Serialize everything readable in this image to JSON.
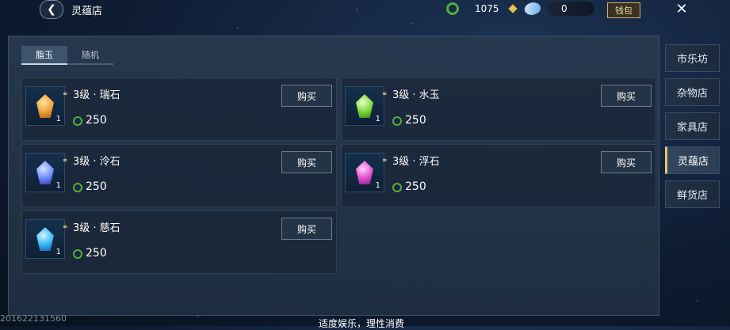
{
  "header": {
    "title": "灵蕴店",
    "coin_value": "1075",
    "gem_value": "0",
    "wallet_label": "钱包"
  },
  "tabs": [
    {
      "label": "脂玉",
      "active": true
    },
    {
      "label": "随机",
      "active": false
    }
  ],
  "items": [
    {
      "name": "3级 · 瑞石",
      "count": "1",
      "price": "250",
      "buy_label": "购买",
      "gem_color": "#f0a43a"
    },
    {
      "name": "3级 · 水玉",
      "count": "1",
      "price": "250",
      "buy_label": "购买",
      "gem_color": "#7ed83c"
    },
    {
      "name": "3级 · 泠石",
      "count": "1",
      "price": "250",
      "buy_label": "购买",
      "gem_color": "#6d8cff"
    },
    {
      "name": "3级 · 浮石",
      "count": "1",
      "price": "250",
      "buy_label": "购买",
      "gem_color": "#e34fd0"
    },
    {
      "name": "3级 · 慈石",
      "count": "1",
      "price": "250",
      "buy_label": "购买",
      "gem_color": "#36b8f5"
    }
  ],
  "sidebar": [
    {
      "label": "市乐坊",
      "active": false
    },
    {
      "label": "杂物店",
      "active": false
    },
    {
      "label": "家具店",
      "active": false
    },
    {
      "label": "灵蕴店",
      "active": true
    },
    {
      "label": "鲜货店",
      "active": false
    }
  ],
  "footer": {
    "id_text": "201622131560",
    "message": "适度娱乐，理性消费"
  },
  "colors": {
    "currency_green": "#4fae3c",
    "accent_gold": "#e1c86c"
  }
}
